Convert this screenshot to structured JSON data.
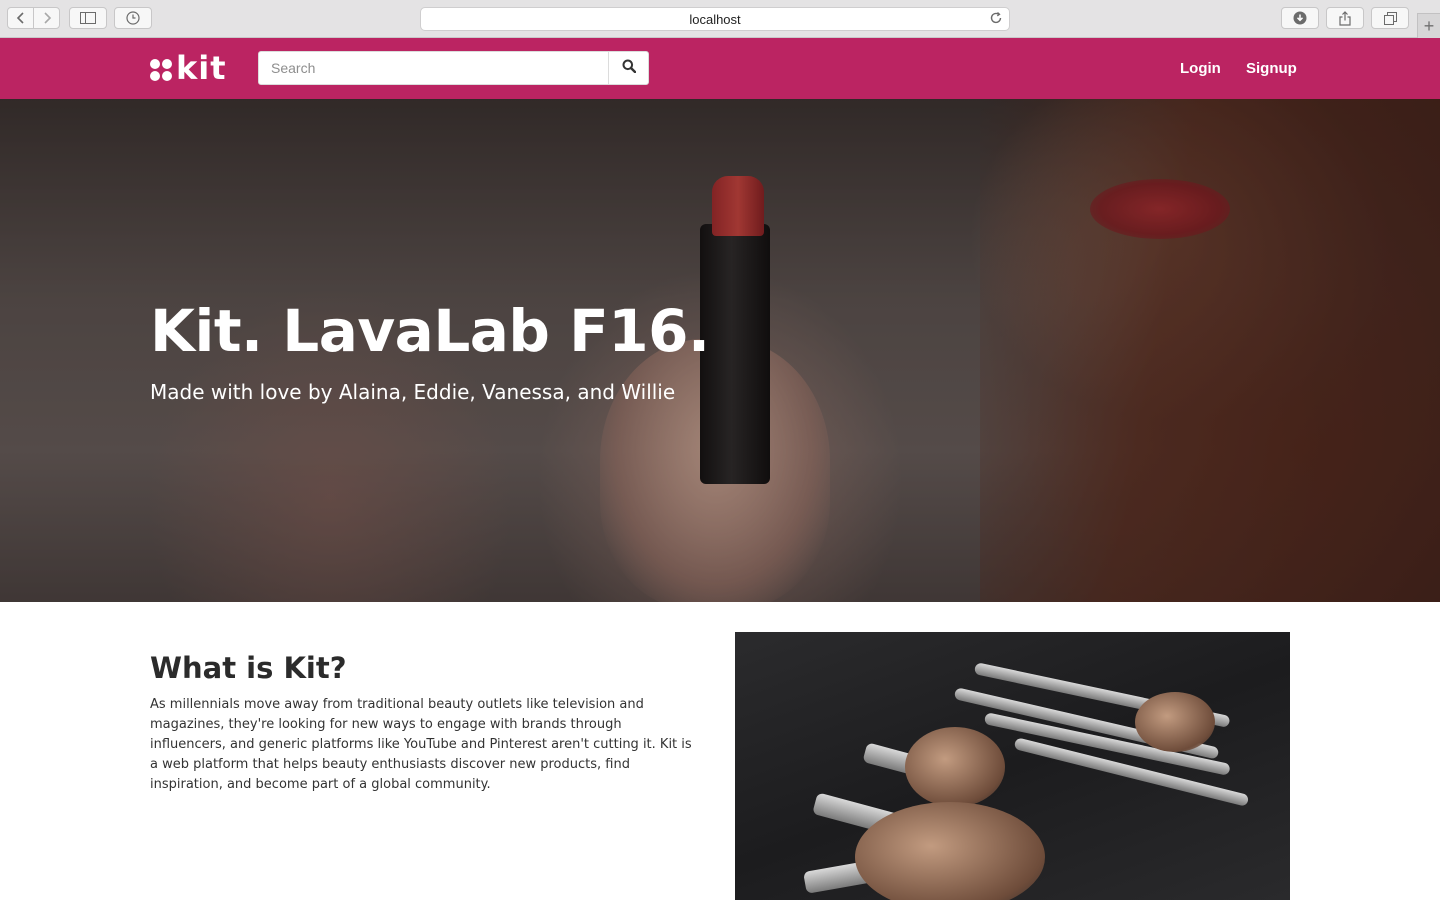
{
  "browser": {
    "url": "localhost",
    "icons": {
      "back": "chevron-left-icon",
      "forward": "chevron-right-icon",
      "sidebar": "sidebar-icon",
      "history": "clock-icon",
      "reload": "reload-icon",
      "downloads": "download-icon",
      "share": "share-icon",
      "tabs": "tabs-icon",
      "new_tab": "plus-icon"
    },
    "new_tab_symbol": "+"
  },
  "nav": {
    "brand": "kit",
    "search_placeholder": "Search",
    "search_value": "",
    "search_icon": "magnifier-icon",
    "login": "Login",
    "signup": "Signup",
    "color": "#bb2462"
  },
  "hero": {
    "title": "Kit. LavaLab F16.",
    "subtitle": "Made with love by Alaina, Eddie, Vanessa, and Willie"
  },
  "about": {
    "title": "What is Kit?",
    "body": "As millennials move away from traditional beauty outlets like television and magazines, they're looking for new ways to engage with brands through influencers, and generic platforms like YouTube and Pinterest aren't cutting it. Kit is a web platform that helps beauty enthusiasts discover new products, find inspiration, and become part of a global community."
  }
}
